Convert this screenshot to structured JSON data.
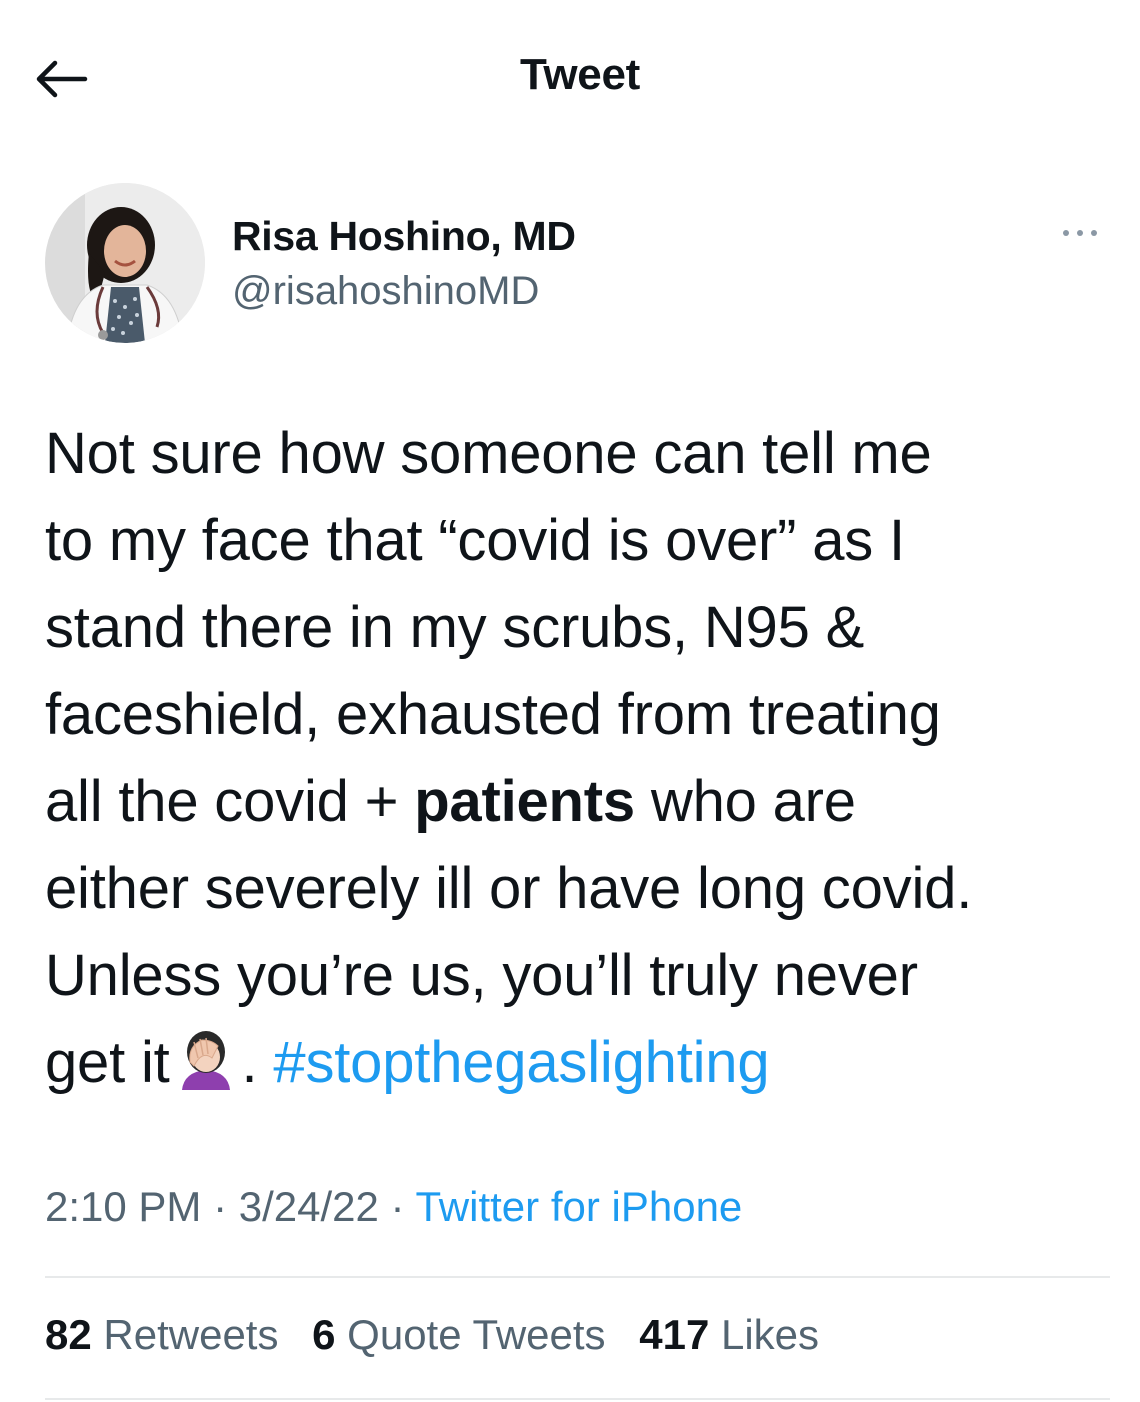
{
  "header": {
    "title": "Tweet",
    "back_icon": "arrow-left-icon"
  },
  "author": {
    "display_name": "Risa Hoshino, MD",
    "handle": "@risahoshinoMD",
    "more_icon": "more-horizontal-icon"
  },
  "tweet": {
    "lines": {
      "l1": "Not sure how someone can tell me",
      "l2": "to my face that “covid is over” as I",
      "l3": "stand there in my scrubs, N95 &",
      "l4": "faceshield, exhausted from treating",
      "l5_pre": "all the covid + ",
      "l5_bold": "patients",
      "l5_post": " who are",
      "l6": "either severely ill or have long covid.",
      "l7": "Unless you’re us, you’ll truly never",
      "l8_pre": "get it",
      "l8_mid": ". ",
      "hashtag": "#stopthegaslighting"
    },
    "emoji": "facepalm-woman-emoji"
  },
  "meta": {
    "time": "2:10 PM",
    "sep1": " · ",
    "date": "3/24/22",
    "sep2": " · ",
    "source": "Twitter for iPhone"
  },
  "stats": {
    "retweets_count": "82",
    "retweets_label": "Retweets",
    "quotes_count": "6",
    "quotes_label": "Quote Tweets",
    "likes_count": "417",
    "likes_label": "Likes"
  },
  "colors": {
    "link": "#1d9bf0",
    "text": "#0f1419",
    "secondary": "#536471",
    "divider": "#e7e9ea"
  }
}
